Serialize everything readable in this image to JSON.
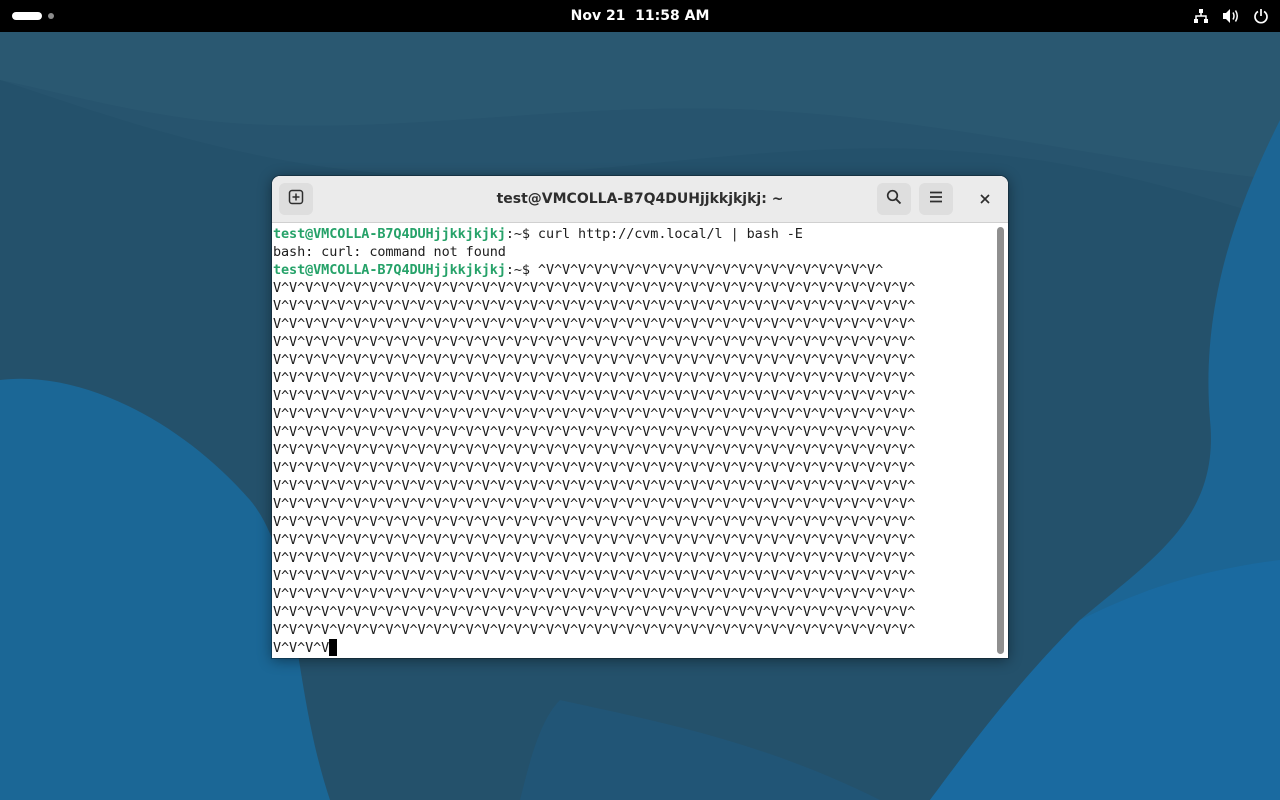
{
  "topbar": {
    "clock": "Nov 21  11:58 AM",
    "icons": [
      "network-icon",
      "volume-icon",
      "power-icon"
    ]
  },
  "window": {
    "title": "test@VMCOLLA-B7Q4DUHjjkkjkjkj: ~",
    "buttons": {
      "new_tab": "new-tab-icon",
      "search": "search-icon",
      "menu": "hamburger-menu-icon",
      "close": "close-icon"
    }
  },
  "terminal": {
    "lines": [
      {
        "user": "test@VMCOLLA-B7Q4DUHjjkkjkjkj",
        "rest": ":~$ curl http://cvm.local/l | bash -E"
      },
      {
        "user": "",
        "rest": "bash: curl: command not found"
      },
      {
        "user": "test@VMCOLLA-B7Q4DUHjjkkjkjkj",
        "rest": ":~$ ^V^V^V^V^V^V^V^V^V^V^V^V^V^V^V^V^V^V^V^V^V^"
      },
      {
        "user": "",
        "rest": "V^V^V^V^V^V^V^V^V^V^V^V^V^V^V^V^V^V^V^V^V^V^V^V^V^V^V^V^V^V^V^V^V^V^V^V^V^V^V^V^"
      },
      {
        "user": "",
        "rest": "V^V^V^V^V^V^V^V^V^V^V^V^V^V^V^V^V^V^V^V^V^V^V^V^V^V^V^V^V^V^V^V^V^V^V^V^V^V^V^V^"
      },
      {
        "user": "",
        "rest": "V^V^V^V^V^V^V^V^V^V^V^V^V^V^V^V^V^V^V^V^V^V^V^V^V^V^V^V^V^V^V^V^V^V^V^V^V^V^V^V^"
      },
      {
        "user": "",
        "rest": "V^V^V^V^V^V^V^V^V^V^V^V^V^V^V^V^V^V^V^V^V^V^V^V^V^V^V^V^V^V^V^V^V^V^V^V^V^V^V^V^"
      },
      {
        "user": "",
        "rest": "V^V^V^V^V^V^V^V^V^V^V^V^V^V^V^V^V^V^V^V^V^V^V^V^V^V^V^V^V^V^V^V^V^V^V^V^V^V^V^V^"
      },
      {
        "user": "",
        "rest": "V^V^V^V^V^V^V^V^V^V^V^V^V^V^V^V^V^V^V^V^V^V^V^V^V^V^V^V^V^V^V^V^V^V^V^V^V^V^V^V^"
      },
      {
        "user": "",
        "rest": "V^V^V^V^V^V^V^V^V^V^V^V^V^V^V^V^V^V^V^V^V^V^V^V^V^V^V^V^V^V^V^V^V^V^V^V^V^V^V^V^"
      },
      {
        "user": "",
        "rest": "V^V^V^V^V^V^V^V^V^V^V^V^V^V^V^V^V^V^V^V^V^V^V^V^V^V^V^V^V^V^V^V^V^V^V^V^V^V^V^V^"
      },
      {
        "user": "",
        "rest": "V^V^V^V^V^V^V^V^V^V^V^V^V^V^V^V^V^V^V^V^V^V^V^V^V^V^V^V^V^V^V^V^V^V^V^V^V^V^V^V^"
      },
      {
        "user": "",
        "rest": "V^V^V^V^V^V^V^V^V^V^V^V^V^V^V^V^V^V^V^V^V^V^V^V^V^V^V^V^V^V^V^V^V^V^V^V^V^V^V^V^"
      },
      {
        "user": "",
        "rest": "V^V^V^V^V^V^V^V^V^V^V^V^V^V^V^V^V^V^V^V^V^V^V^V^V^V^V^V^V^V^V^V^V^V^V^V^V^V^V^V^"
      },
      {
        "user": "",
        "rest": "V^V^V^V^V^V^V^V^V^V^V^V^V^V^V^V^V^V^V^V^V^V^V^V^V^V^V^V^V^V^V^V^V^V^V^V^V^V^V^V^"
      },
      {
        "user": "",
        "rest": "V^V^V^V^V^V^V^V^V^V^V^V^V^V^V^V^V^V^V^V^V^V^V^V^V^V^V^V^V^V^V^V^V^V^V^V^V^V^V^V^"
      },
      {
        "user": "",
        "rest": "V^V^V^V^V^V^V^V^V^V^V^V^V^V^V^V^V^V^V^V^V^V^V^V^V^V^V^V^V^V^V^V^V^V^V^V^V^V^V^V^"
      },
      {
        "user": "",
        "rest": "V^V^V^V^V^V^V^V^V^V^V^V^V^V^V^V^V^V^V^V^V^V^V^V^V^V^V^V^V^V^V^V^V^V^V^V^V^V^V^V^"
      },
      {
        "user": "",
        "rest": "V^V^V^V^V^V^V^V^V^V^V^V^V^V^V^V^V^V^V^V^V^V^V^V^V^V^V^V^V^V^V^V^V^V^V^V^V^V^V^V^"
      },
      {
        "user": "",
        "rest": "V^V^V^V^V^V^V^V^V^V^V^V^V^V^V^V^V^V^V^V^V^V^V^V^V^V^V^V^V^V^V^V^V^V^V^V^V^V^V^V^"
      },
      {
        "user": "",
        "rest": "V^V^V^V^V^V^V^V^V^V^V^V^V^V^V^V^V^V^V^V^V^V^V^V^V^V^V^V^V^V^V^V^V^V^V^V^V^V^V^V^"
      },
      {
        "user": "",
        "rest": "V^V^V^V^V^V^V^V^V^V^V^V^V^V^V^V^V^V^V^V^V^V^V^V^V^V^V^V^V^V^V^V^V^V^V^V^V^V^V^V^"
      },
      {
        "user": "",
        "rest": "V^V^V^V^V^V^V^V^V^V^V^V^V^V^V^V^V^V^V^V^V^V^V^V^V^V^V^V^V^V^V^V^V^V^V^V^V^V^V^V^"
      },
      {
        "user": "",
        "rest": "V^V^V^V"
      }
    ]
  },
  "colors": {
    "prompt_user": "#26a269",
    "wallpaper_base": "#1f5472",
    "topbar": "#000000"
  }
}
